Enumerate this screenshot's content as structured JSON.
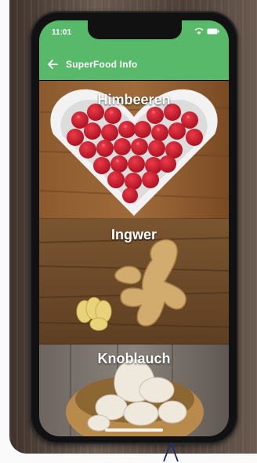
{
  "status": {
    "time": "11:01"
  },
  "appbar": {
    "title": "SuperFood Info"
  },
  "tiles": [
    {
      "label": "Himbeeren"
    },
    {
      "label": "Ingwer"
    },
    {
      "label": "Knoblauch"
    }
  ],
  "icons": {
    "back": "arrow-left-icon",
    "wifi": "wifi-icon",
    "battery": "battery-icon",
    "cursor": "pointer-cursor-icon"
  },
  "colors": {
    "appbar": "#58b96a"
  }
}
